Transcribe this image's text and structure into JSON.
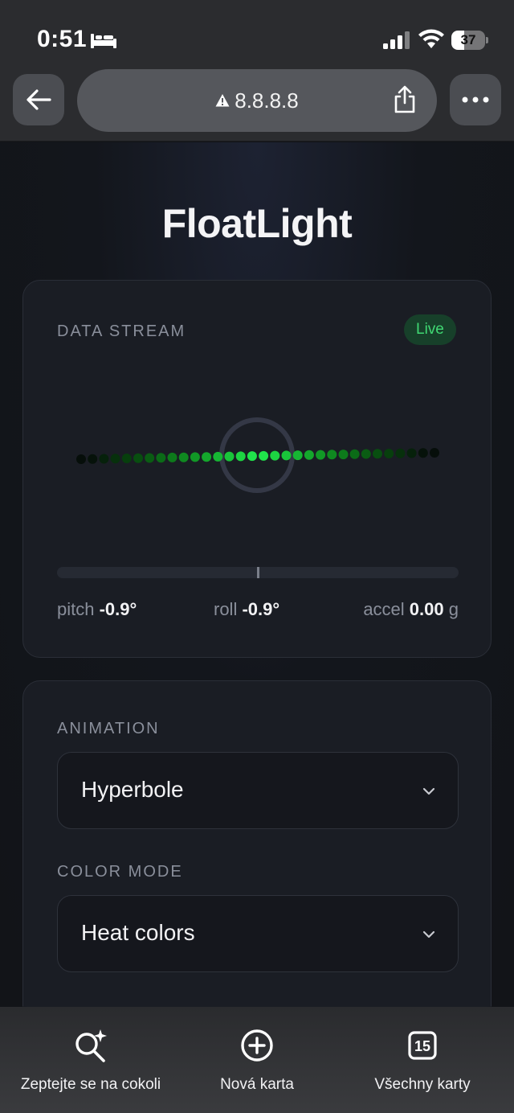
{
  "status_bar": {
    "time": "0:51",
    "battery_level": 37,
    "battery_text": "37"
  },
  "browser": {
    "url": "8.8.8.8"
  },
  "app": {
    "title": "FloatLight"
  },
  "data_stream": {
    "label": "DATA STREAM",
    "status_badge": "Live",
    "pitch_label": "pitch",
    "pitch_value": "-0.9°",
    "roll_label": "roll",
    "roll_value": "-0.9°",
    "accel_label": "accel",
    "accel_value": "0.00",
    "accel_unit": "g",
    "track_marker_fraction": 0.5,
    "led_count": 32
  },
  "settings": {
    "animation_label": "ANIMATION",
    "animation_value": "Hyperbole",
    "color_mode_label": "COLOR MODE",
    "color_mode_value": "Heat colors"
  },
  "bottom_bar": {
    "ask_label": "Zeptejte se na cokoli",
    "new_tab_label": "Nová karta",
    "all_tabs_label": "Všechny karty",
    "tab_count": "15"
  },
  "colors": {
    "accent_green": "#40d873",
    "live_badge_bg": "#17402a"
  }
}
